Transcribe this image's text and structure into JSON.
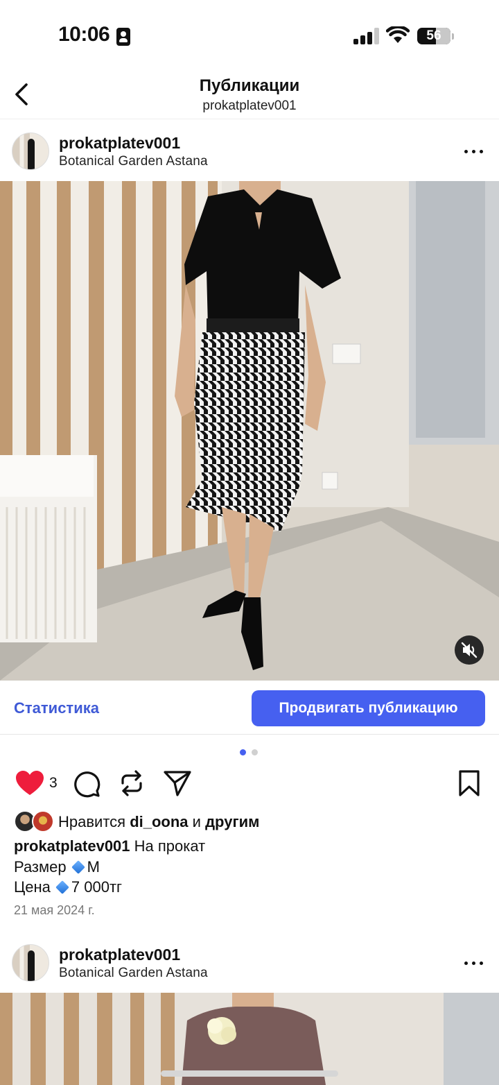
{
  "status_bar": {
    "time": "10:06",
    "battery": "56",
    "battery_level_percent": 56
  },
  "header": {
    "title": "Публикации",
    "subtitle": "prokatplatev001"
  },
  "posts": [
    {
      "username": "prokatplatev001",
      "location": "Botanical Garden Astana",
      "stats_label": "Статистика",
      "promote_label": "Продвигать публикацию",
      "carousel_count": 2,
      "carousel_index": 1,
      "likes_count": "3",
      "likes": {
        "prefix": "Нравится",
        "user": "di_oona",
        "conjunction": "и",
        "others": "другим"
      },
      "caption": {
        "username": "prokatplatev001",
        "text": "На прокат",
        "size_label": "Размер",
        "size_value": "M",
        "price_label": "Цена",
        "price_value": "7 000тг"
      },
      "date": "21 мая 2024 г."
    },
    {
      "username": "prokatplatev001",
      "location": "Botanical Garden Astana"
    }
  ],
  "colors": {
    "accent": "#4660f0",
    "link": "#3f5ad6",
    "like": "#ee1d3c"
  }
}
